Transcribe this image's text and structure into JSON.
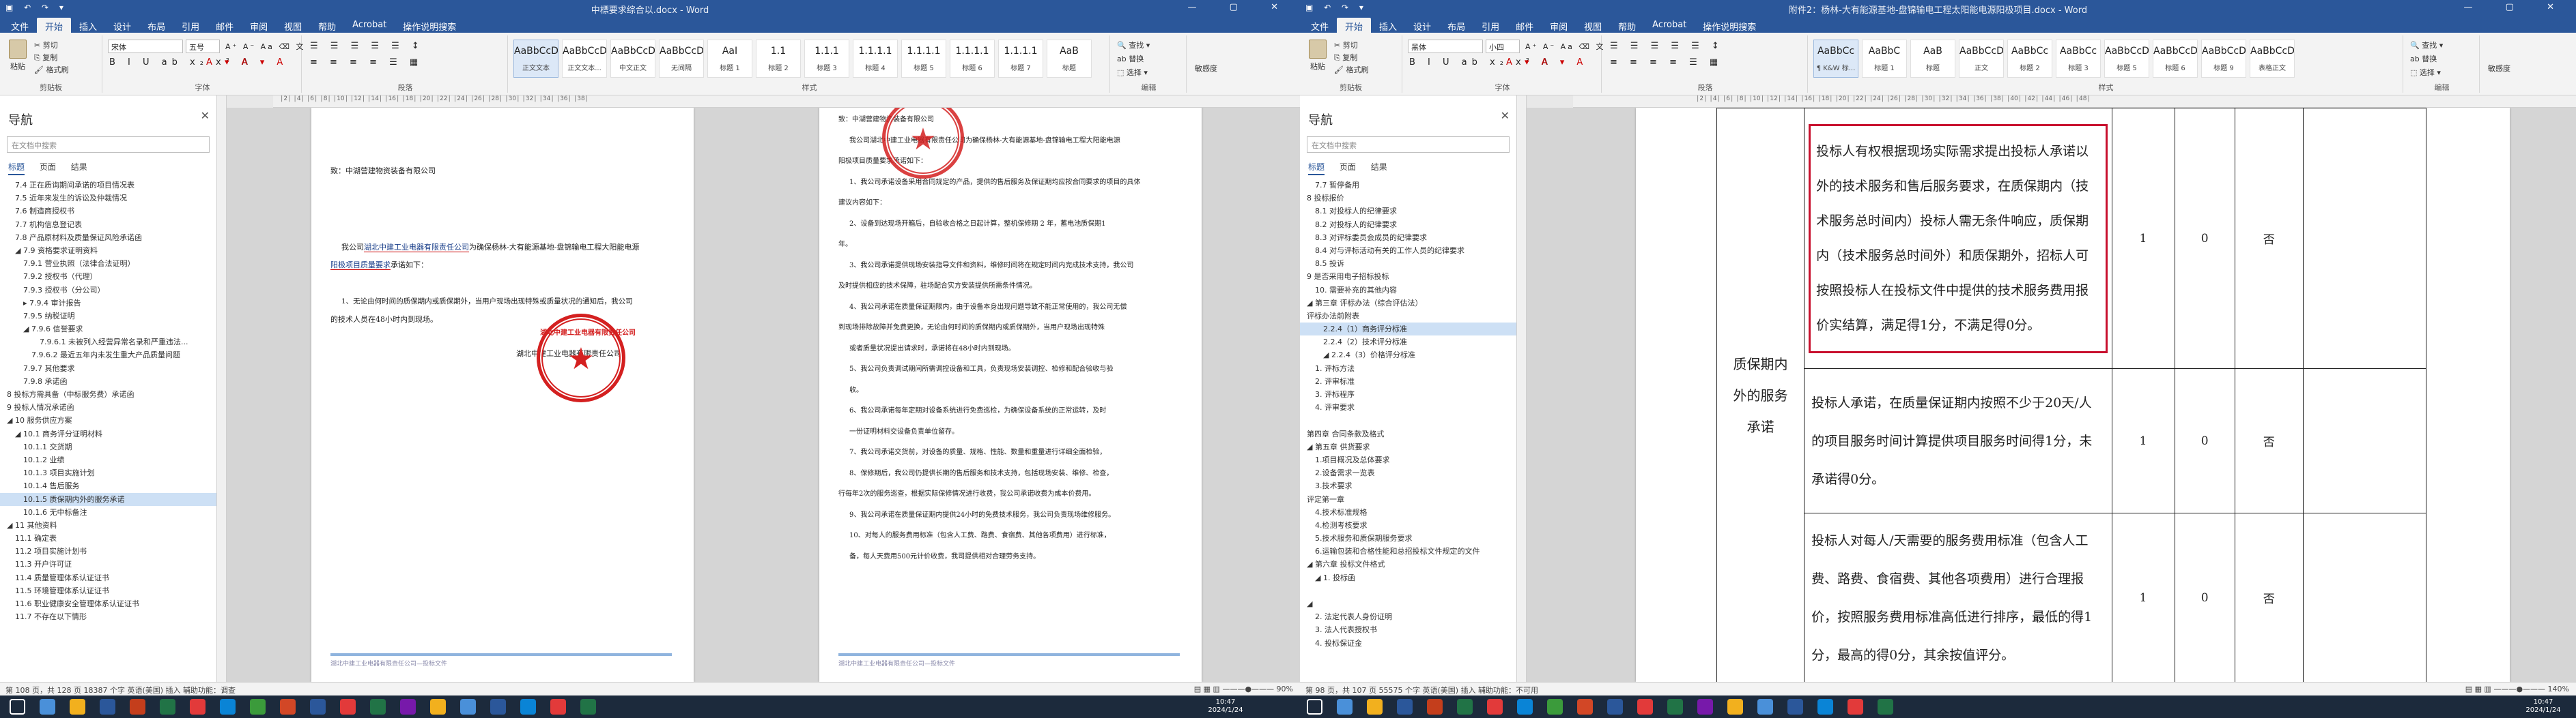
{
  "left": {
    "title": "中標要求综合以.docx - Word",
    "qat": "▣ ↶ ↷ ▾",
    "window_controls": "— ▢ ✕",
    "tabs": [
      "文件",
      "开始",
      "插入",
      "设计",
      "布局",
      "引用",
      "邮件",
      "审阅",
      "视图",
      "帮助",
      "Acrobat",
      "操作说明搜索"
    ],
    "ribbon": {
      "paste": "粘贴",
      "cut": "✂ 剪切",
      "copy": "⎘ 复制",
      "format_painter": "🖌 格式刷",
      "clipboard_label": "剪贴板",
      "font_name": "宋体",
      "font_size": "五号",
      "font_label": "字体",
      "format_row1": "A⁺ A⁻ Aa ⌫ 文",
      "format_row2": "B I U ab x₂ x² A",
      "format_row3": "A ▾ A ▾ A",
      "para_row1": "☰ ☰ ☰ ☰ ☰ ↕",
      "para_row2": "≡ ≡ ≡ ≡ ☰ ▦",
      "para_label": "段落",
      "styles": [
        {
          "sample": "AaBbCcDd",
          "name": "正文文本"
        },
        {
          "sample": "AaBbCcDd",
          "name": "正文文本..."
        },
        {
          "sample": "AaBbCcDd",
          "name": "中文正文"
        },
        {
          "sample": "AaBbCcDd",
          "name": "无间隔"
        },
        {
          "sample": "AaI",
          "name": "标题 1"
        },
        {
          "sample": "1.1",
          "name": "标题 2"
        },
        {
          "sample": "1.1.1",
          "name": "标题 3"
        },
        {
          "sample": "1.1.1.1",
          "name": "标题 4"
        },
        {
          "sample": "1.1.1.1",
          "name": "标题 5"
        },
        {
          "sample": "1.1.1.1",
          "name": "标题 6"
        },
        {
          "sample": "1.1.1.1",
          "name": "标题 7"
        },
        {
          "sample": "AaB",
          "name": "标题"
        }
      ],
      "styles_label": "样式",
      "find": "🔍 查找 ▾",
      "replace": "ab 替换",
      "select": "⬚ 选择 ▾",
      "edit_label": "编辑",
      "sensitivity": "敏感度"
    },
    "nav": {
      "title": "导航",
      "close": "✕",
      "search_placeholder": "在文档中搜索",
      "tabs": [
        "标题",
        "页面",
        "结果"
      ],
      "items": [
        "7.4 正在质询期间承诺的项目情况表",
        "7.5 近年来发生的诉讼及仲裁情况",
        "7.6 制造商授权书",
        "7.7 机构信息登记表",
        "7.8 产品原材料及质量保证风险承诺函",
        "◢ 7.9 资格要求证明资料",
        "7.9.1 营业执照（法律合法证明）",
        "7.9.2 授权书（代理）",
        "7.9.3 授权书（分公司）",
        "▸ 7.9.4 审计报告",
        "7.9.5 纳税证明",
        "◢ 7.9.6 信誉要求",
        "7.9.6.1 未被列入经营异常名录和严重违法...",
        "7.9.6.2 最近五年内未发生重大产品质量问题",
        "7.9.7 其他要求",
        "7.9.8 承诺函",
        "8 投标方需具备（中标服务费）承诺函",
        "9 投标人情况承诺函",
        "◢ 10 服务供应方案",
        "◢ 10.1 商务评分证明材料",
        "10.1.1 交货期",
        "10.1.2 业绩",
        "10.1.3 项目实施计划",
        "10.1.4 售后服务",
        "10.1.5 质保期内外的服务承诺",
        "10.1.6 无中标备注",
        "◢ 11 其他资料",
        "11.1 确定表",
        "11.2 项目实施计划书",
        "11.3 开户许可证",
        "11.4 质量管理体系认证证书",
        "11.5 环境管理体系认证证书",
        "11.6 职业健康安全管理体系认证证书",
        "11.7 不存在以下情形"
      ],
      "selected_index": 24
    },
    "ruler_marks": "│2│ │4│ │6│ │8│ │10│ │12│ │14│ │16│ │18│ │20│ │22│ │24│ │26│ │28│ │30│ │32│ │34│ │36│ │38│",
    "page1": {
      "to": "致：中湖营建物资装备有限公司",
      "l1a": "我公司",
      "l1b": "湖北中建工业电器有限责任公司",
      "l1c": "为确保杨林-大有能源基地-盘锦输电工程大阳能电源",
      "l2a": "阳极项目",
      "l2b": "质量要求",
      "l2c": "承诺如下：",
      "l3": "1、无论由何时间的质保期内或质保期外，当用户现场出现特殊或质量状况的通知后，我公司",
      "l4": "的技术人员在48小时内到现场。",
      "sign": "湖北中建工业电器有限责任公司",
      "stamp_text": "湖北中建工业电器有限责任公司",
      "footer": "湖北中建工业电器有限责任公司—投标文件"
    },
    "page2": {
      "lines": [
        "致：中湖营建物资装备有限公司",
        "我公司湖北中建工业电器有限责任公司为确保杨林-大有能源基地-盘锦输电工程大阳能电源",
        "阳极项目质量要求承诺如下：",
        "1、我公司承诺设备采用合同规定的产品，提供的售后服务及保证期均应按合同要求的项目的具体",
        "建议内容如下：",
        "2、设备到达现场开箱后，自验收合格之日起计算，整机保修期 2 年，蓄电池质保期1",
        "年。",
        "3、我公司承诺提供现场安装指导文件和资料，维修时间将在规定时间内完成技术支持，我公司",
        "及时提供相应的技术保障，驻场配合实方安装提供所需条件情况。",
        "4、我公司承诺在质量保证期限内，由于设备本身出现问题导致不能正常使用的，我公司无偿",
        "到现场排除故障并免费更换，无论由何时间的质保期内或质保期外，当用户现场出现特殊",
        "或者质量状况提出请求时，承诺将在48小时内到现场。",
        "5、我公司负责调试期间所需调控设备和工具，负责现场安装调控、检修和配合验收与验",
        "收。",
        "6、我公司承诺每年定期对设备系统进行免费巡检，为确保设备系统的正常运转，及时",
        "一份证明材料交设备负责单位留存。",
        "7、我公司承诺交货前，对设备的质量、规格、性能、数量和重量进行详细全面检验，",
        "8、保修期后，我公司仍提供长期的售后服务和技术支持，包括现场安装、维修、检查，",
        "行每年2次的服务巡查，根据实际保修情况进行收费，我公司承诺收费为成本价费用。",
        "9、我公司承诺在质量保证期内提供24小时的免费技术服务，我公司负责现场维修服务。",
        "10、对每人的服务费用标准（包含人工费、路费、食宿费、其他各项费用）进行标准，",
        "备，每人天费用500元计价收费，我司提供相对合理劳务支持。"
      ],
      "footer": "湖北中建工业电器有限责任公司—投标文件"
    },
    "status": {
      "left": "第 108 页，共 128 页    18387 个字    英语(美国)    插入    辅助功能：调查",
      "right": "▤ ▦ ▥  ———●——— 90%"
    }
  },
  "right": {
    "title": "附件2：杨林-大有能源基地-盘锦输电工程太阳能电源阳极项目.docx - Word",
    "qat": "▣ ↶ ↷ ▾",
    "window_controls": "— ▢ ✕",
    "tabs": [
      "文件",
      "开始",
      "插入",
      "设计",
      "布局",
      "引用",
      "邮件",
      "审阅",
      "视图",
      "帮助",
      "Acrobat",
      "操作说明搜索"
    ],
    "ribbon": {
      "paste": "粘贴",
      "cut": "✂ 剪切",
      "copy": "⎘ 复制",
      "format_painter": "🖌 格式刷",
      "clipboard_label": "剪贴板",
      "font_name": "黑体",
      "font_size": "小四",
      "font_label": "字体",
      "format_row1": "A⁺ A⁻ Aa ⌫ 文",
      "format_row2": "B I U ab x₂ x² A",
      "format_row3": "A ▾ A ▾ A",
      "para_row1": "☰ ☰ ☰ ☰ ☰ ↕",
      "para_row2": "≡ ≡ ≡ ≡ ☰ ▦",
      "para_label": "段落",
      "styles": [
        {
          "sample": "AaBbCc",
          "name": "¶ K&W 标..."
        },
        {
          "sample": "AaBbC",
          "name": "标题 1"
        },
        {
          "sample": "AaB",
          "name": "标题"
        },
        {
          "sample": "AaBbCcD",
          "name": "正文"
        },
        {
          "sample": "AaBbCc",
          "name": "标题 2"
        },
        {
          "sample": "AaBbCc",
          "name": "标题 3"
        },
        {
          "sample": "AaBbCcD",
          "name": "标题 5"
        },
        {
          "sample": "AaBbCcD",
          "name": "标题 6"
        },
        {
          "sample": "AaBbCcD",
          "name": "标题 9"
        },
        {
          "sample": "AaBbCcD",
          "name": "表格正文"
        }
      ],
      "styles_label": "样式",
      "find": "🔍 查找 ▾",
      "replace": "ab 替换",
      "select": "⬚ 选择 ▾",
      "edit_label": "编辑",
      "sensitivity": "敏感度"
    },
    "nav": {
      "title": "导航",
      "close": "✕",
      "search_placeholder": "在文档中搜索",
      "tabs": [
        "标题",
        "页面",
        "结果"
      ],
      "items": [
        "7.7 暂停备用",
        "8 投标报价",
        "8.1 对投标人的纪律要求",
        "8.2 对投标人的纪律要求",
        "8.3 对评标委员会成员的纪律要求",
        "8.4 对与评标活动有关的工作人员的纪律要求",
        "8.5 投诉",
        "9 是否采用电子招标投标",
        "10. 需要补充的其他内容",
        "◢ 第三章  评标办法（综合评估法）",
        "评标办法前附表",
        "2.2.4（1）商务评分标准",
        "2.2.4（2）技术评分标准",
        "◢ 2.2.4（3）价格评分标准",
        "1. 评标方法",
        "2. 评审标准",
        "3. 评标程序",
        "4. 评审要求",
        "",
        "第四章  合同条款及格式",
        "◢ 第五章  供货要求",
        "1.项目概况及总体要求",
        "2.设备需求一览表",
        "3.技术要求",
        "评定第一章",
        "4.技术标准规格",
        "4.检测考核要求",
        "5.技术服务和质保期服务要求",
        "6.运输包装和合格性能和总招投标文件规定的文件",
        "◢ 第六章  投标文件格式",
        "◢ 1. 投标函",
        "",
        "◢ ",
        "2. 法定代表人身份证明",
        "3. 法人代表授权书",
        "4. 投标保证金"
      ],
      "selected_index": 11
    },
    "ruler_marks": "│2│ │4│ │6│ │8│ │10│ │12│ │14│ │16│ │18│ │20│ │22│ │24│ │26│ │28│ │30│ │32│ │34│ │36│ │38│ │40│ │42│ │44│ │46│ │48│",
    "table": {
      "category": "质保期内外的服务承诺",
      "rows": [
        {
          "text": "投标人有权根据现场实际需求提出投标人承诺以外的技术服务和售后服务要求，在质保期内（技术服务总时间内）投标人需无条件响应，质保期内（技术服务总时间外）和质保期外，招标人可按照投标人在投标文件中提供的技术服务费用报价实结算，满足得1分，不满足得0分。",
          "score": "1",
          "c1": "0",
          "c2": "否"
        },
        {
          "text": "投标人承诺，在质量保证期内按照不少于20天/人的项目服务时间计算提供项目服务时间得1分，未承诺得0分。",
          "score": "1",
          "c1": "0",
          "c2": "否"
        },
        {
          "text": "投标人对每人/天需要的服务费用标准（包含人工费、路费、食宿费、其他各项费用）进行合理报价，按照服务费用标准高低进行排序，最低的得1分，最高的得0分，其余按值评分。",
          "score": "1",
          "c1": "0",
          "c2": "否"
        }
      ]
    },
    "status": {
      "left": "第 98 页，共 107 页    55575 个字    英语(美国)    插入    辅助功能：不可用",
      "right": "▤ ▦ ▥  ———●——— 140%"
    }
  },
  "taskbar": {
    "left_clock": "10:47\n2024/1/24",
    "right_clock": "10:47\n2024/1/24"
  }
}
